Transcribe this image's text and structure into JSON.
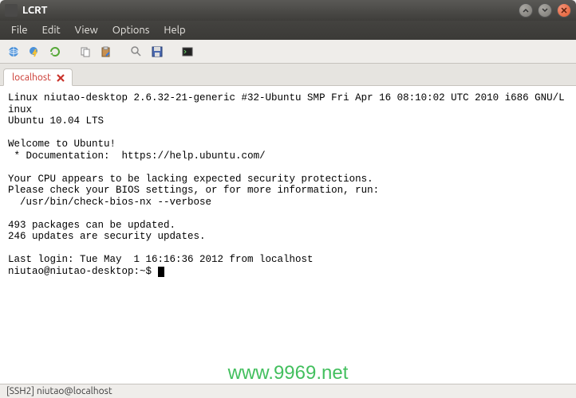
{
  "window": {
    "title": "LCRT"
  },
  "menu": {
    "items": [
      "File",
      "Edit",
      "View",
      "Options",
      "Help"
    ]
  },
  "tabs": [
    {
      "label": "localhost"
    }
  ],
  "terminal": {
    "lines": [
      "Linux niutao-desktop 2.6.32-21-generic #32-Ubuntu SMP Fri Apr 16 08:10:02 UTC 2010 i686 GNU/Linux",
      "Ubuntu 10.04 LTS",
      "",
      "Welcome to Ubuntu!",
      " * Documentation:  https://help.ubuntu.com/",
      "",
      "Your CPU appears to be lacking expected security protections.",
      "Please check your BIOS settings, or for more information, run:",
      "  /usr/bin/check-bios-nx --verbose",
      "",
      "493 packages can be updated.",
      "246 updates are security updates.",
      "",
      "Last login: Tue May  1 16:16:36 2012 from localhost"
    ],
    "prompt": "niutao@niutao-desktop:~$ "
  },
  "statusbar": {
    "text": "[SSH2] niutao@localhost"
  },
  "watermark": "www.9969.net",
  "colors": {
    "tab_active_text": "#c9332b",
    "watermark": "#2fb94d"
  }
}
